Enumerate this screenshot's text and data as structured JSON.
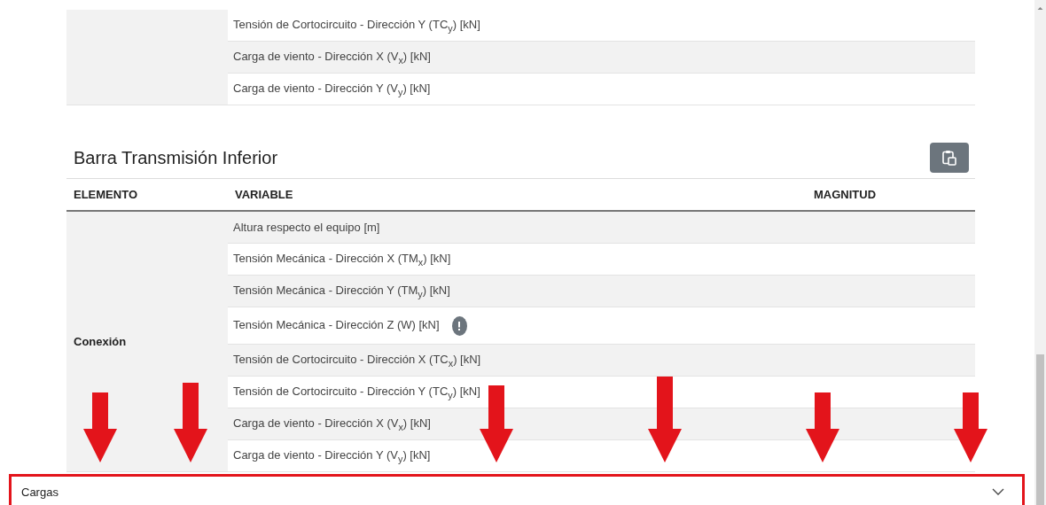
{
  "upper_table": {
    "rows": [
      {
        "variable": "Tensión de Cortocircuito - Dirección Y (TC$_{y}$) [kN]",
        "alert": false
      },
      {
        "variable": "Carga de viento - Dirección X (V$_{x}$) [kN]",
        "alert": false
      },
      {
        "variable": "Carga de viento - Dirección Y (V$_{y}$) [kN]",
        "alert": false
      }
    ]
  },
  "section": {
    "title": "Barra Transmisión Inferior",
    "columns": [
      "ELEMENTO",
      "VARIABLE",
      "MAGNITUD"
    ],
    "groups": [
      {
        "element": "Conexión",
        "rows": [
          {
            "variable": "Altura respecto el equipo [m]",
            "alert": false
          },
          {
            "variable": "Tensión Mecánica - Dirección X (TM$_{x}$) [kN]",
            "alert": false
          },
          {
            "variable": "Tensión Mecánica - Dirección Y (TM$_{y}$) [kN]",
            "alert": false
          },
          {
            "variable": "Tensión Mecánica - Dirección Z (W) [kN]",
            "alert": true
          },
          {
            "variable": "Tensión de Cortocircuito - Dirección X (TC$_{x}$) [kN]",
            "alert": false
          },
          {
            "variable": "Tensión de Cortocircuito - Dirección Y (TC$_{y}$) [kN]",
            "alert": false
          },
          {
            "variable": "Carga de viento - Dirección X (V$_{x}$) [kN]",
            "alert": false
          },
          {
            "variable": "Carga de viento - Dirección Y (V$_{y}$) [kN]",
            "alert": false
          }
        ]
      }
    ]
  },
  "accordion": {
    "label": "Cargas",
    "expanded": false,
    "highlighted": true
  }
}
